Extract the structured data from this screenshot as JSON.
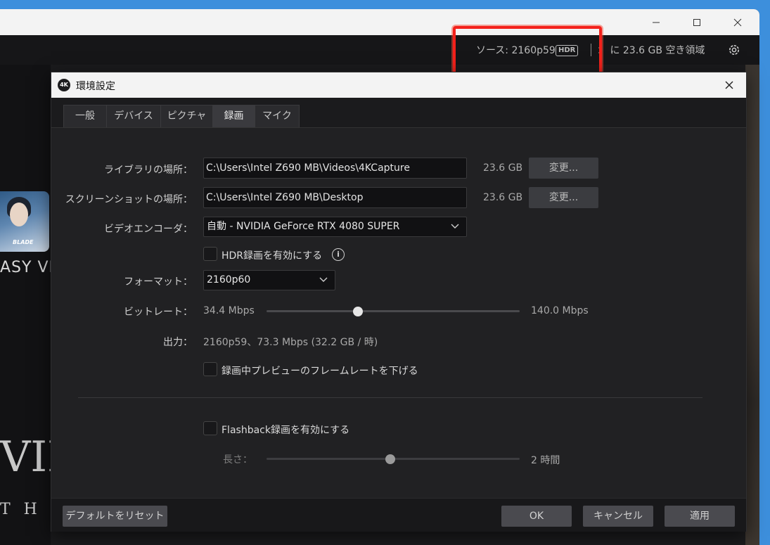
{
  "main_window": {
    "toolbar": {
      "source_label": "ソース: 2160p59",
      "hdr_badge": "HDR",
      "free_space": "： に 23.6 GB 空き領域"
    },
    "background": {
      "thumbnail_logo": "BLADE",
      "side_text": "ASY VII",
      "roman_numeral": "VII",
      "roman_sub": "T H"
    }
  },
  "dialog": {
    "title": "環境設定",
    "icon_text": "4K",
    "tabs": [
      {
        "label": "一般"
      },
      {
        "label": "デバイス"
      },
      {
        "label": "ピクチャ"
      },
      {
        "label": "録画",
        "active": true
      },
      {
        "label": "マイク"
      }
    ],
    "library": {
      "label": "ライブラリの場所：",
      "path": "C:\\Users\\Intel Z690 MB\\Videos\\4KCapture",
      "size": "23.6 GB",
      "change_button": "変更..."
    },
    "screenshot": {
      "label": "スクリーンショットの場所：",
      "path": "C:\\Users\\Intel Z690 MB\\Desktop",
      "size": "23.6 GB",
      "change_button": "変更..."
    },
    "encoder": {
      "label": "ビデオエンコーダ：",
      "value": "自動 - NVIDIA GeForce RTX 4080 SUPER"
    },
    "hdr_recording": {
      "label": "HDR録画を有効にする",
      "checked": false
    },
    "format": {
      "label": "フォーマット：",
      "value": "2160p60"
    },
    "bitrate": {
      "label": "ビットレート：",
      "min": "34.4 Mbps",
      "max": "140.0 Mbps",
      "position_fraction": 0.36
    },
    "output": {
      "label": "出力：",
      "value": "2160p59、73.3 Mbps (32.2 GB / 時)"
    },
    "lower_preview_fps": {
      "label": "録画中プレビューのフレームレートを下げる",
      "checked": false
    },
    "flashback": {
      "label": "Flashback録画を有効にする",
      "checked": false
    },
    "length": {
      "label": "長さ：",
      "value": "2 時間",
      "position_fraction": 0.49
    },
    "footer": {
      "reset_button": "デフォルトをリセット",
      "ok_button": "OK",
      "cancel_button": "キャンセル",
      "apply_button": "適用"
    }
  }
}
